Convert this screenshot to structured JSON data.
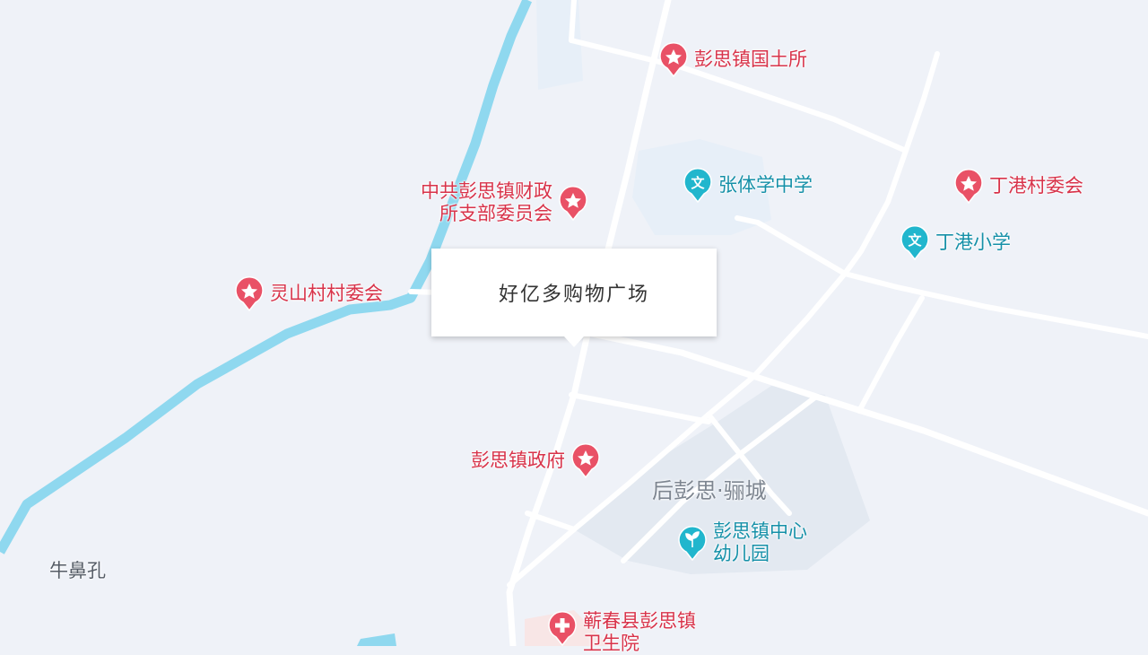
{
  "map": {
    "colors": {
      "background": "#eff2f8",
      "road": "#ffffff",
      "river": "#8fd8ef",
      "block": "#e3e9f1",
      "poi_red": "#e95166",
      "poi_teal": "#21b6cd",
      "label_red": "#d8334a",
      "label_teal": "#1590a8"
    }
  },
  "popup": {
    "title": "好亿多购物广场"
  },
  "pois": [
    {
      "id": "guotu",
      "label": [
        "彭思镇国土所"
      ],
      "icon": "government-star-icon",
      "color": "#e95166",
      "text_color": "#d8334a"
    },
    {
      "id": "caizheng",
      "label": [
        "中共彭思镇财政",
        "所支部委员会"
      ],
      "icon": "government-star-icon",
      "color": "#e95166",
      "text_color": "#d8334a"
    },
    {
      "id": "zhangti",
      "label": [
        "张体学中学"
      ],
      "icon": "school-icon",
      "glyph": "文",
      "color": "#21b6cd",
      "text_color": "#1590a8"
    },
    {
      "id": "dinggang-cun",
      "label": [
        "丁港村委会"
      ],
      "icon": "government-star-icon",
      "color": "#e95166",
      "text_color": "#d8334a"
    },
    {
      "id": "dinggang-xx",
      "label": [
        "丁港小学"
      ],
      "icon": "school-icon",
      "glyph": "文",
      "color": "#21b6cd",
      "text_color": "#1590a8"
    },
    {
      "id": "lingshan",
      "label": [
        "灵山村村委会"
      ],
      "icon": "government-star-icon",
      "color": "#e95166",
      "text_color": "#d8334a"
    },
    {
      "id": "zhengfu",
      "label": [
        "彭思镇政府"
      ],
      "icon": "government-star-icon",
      "color": "#e95166",
      "text_color": "#d8334a"
    },
    {
      "id": "youer",
      "label": [
        "彭思镇中心",
        "幼儿园"
      ],
      "icon": "kindergarten-sprout-icon",
      "color": "#21b6cd",
      "text_color": "#1590a8"
    },
    {
      "id": "weisheng",
      "label": [
        "蕲春县彭思镇",
        "卫生院"
      ],
      "icon": "hospital-cross-icon",
      "color": "#e95166",
      "text_color": "#d8334a"
    }
  ],
  "places": [
    {
      "id": "houpengsi",
      "label": "后彭思·骊城"
    },
    {
      "id": "niubikong",
      "label": "牛鼻孔"
    }
  ]
}
